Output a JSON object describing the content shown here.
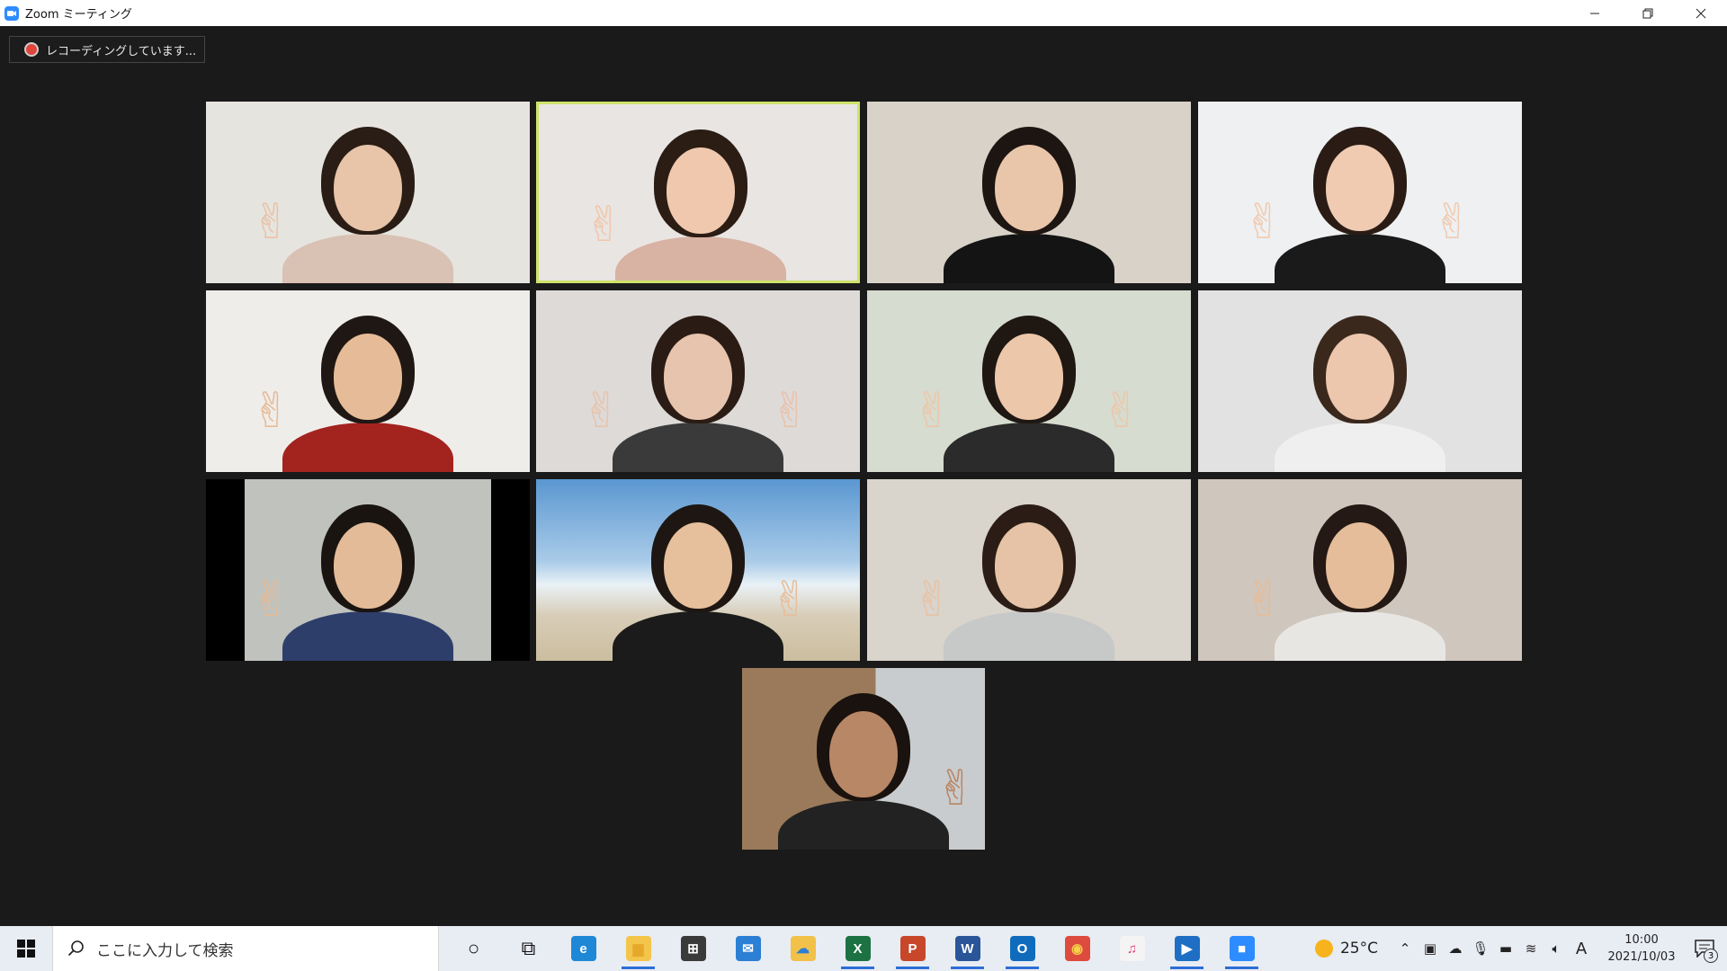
{
  "window": {
    "title": "Zoom ミーティング",
    "controls": [
      "minimize-button",
      "restore-button",
      "close-button"
    ]
  },
  "recording": {
    "label": "レコーディングしています..."
  },
  "participants": [
    {
      "id": "p1",
      "active": false,
      "bg": "#e6e4df",
      "skin": "#e8c4a8",
      "hair": "#2a1d16",
      "top": "#d9c1b4",
      "peace": "left"
    },
    {
      "id": "p2",
      "active": true,
      "bg": "#e9e5e2",
      "skin": "#efc8ad",
      "hair": "#2b1c14",
      "top": "#d8b2a3",
      "peace": "left"
    },
    {
      "id": "p3",
      "active": false,
      "bg": "#d8d2c8",
      "skin": "#e9c6aa",
      "hair": "#1d1512",
      "top": "#141414",
      "peace": "none"
    },
    {
      "id": "p4",
      "active": false,
      "bg": "#eef0f2",
      "skin": "#f0cbb1",
      "hair": "#2a1c15",
      "top": "#1a1a1a",
      "peace": "both"
    },
    {
      "id": "p5",
      "active": false,
      "bg": "#efedea",
      "skin": "#e6bc98",
      "hair": "#1f1713",
      "top": "#a3231f",
      "peace": "left"
    },
    {
      "id": "p6",
      "active": false,
      "bg": "#dedad8",
      "skin": "#e7c4ad",
      "hair": "#2a1c15",
      "top": "#3a3a3a",
      "peace": "both"
    },
    {
      "id": "p7",
      "active": false,
      "bg": "#d6dccf",
      "skin": "#ecc7aa",
      "hair": "#1f1712",
      "top": "#2b2b2b",
      "peace": "both"
    },
    {
      "id": "p8",
      "active": false,
      "bg": "#e2e2e2",
      "skin": "#ecc6ad",
      "hair": "#3a281d",
      "top": "#efefef",
      "peace": "none"
    },
    {
      "id": "p9",
      "active": false,
      "bg": "#cfd0cb",
      "skin": "#e3bb98",
      "hair": "#1a1411",
      "top": "#2e3e6b",
      "peace": "left"
    },
    {
      "id": "p10",
      "active": false,
      "bg": "#6ba4d8",
      "skin": "#e6bf9c",
      "hair": "#1e1612",
      "top": "#1b1b1b",
      "peace": "right"
    },
    {
      "id": "p11",
      "active": false,
      "bg": "#d9d4cc",
      "skin": "#e6c3a6",
      "hair": "#2b1d15",
      "top": "#c7c8c8",
      "peace": "left"
    },
    {
      "id": "p12",
      "active": false,
      "bg": "#cfc6bd",
      "skin": "#e5bd9a",
      "hair": "#241914",
      "top": "#e8e6e3",
      "peace": "left"
    },
    {
      "id": "p13",
      "active": false,
      "bg": "#9a7a5a",
      "skin": "#b88766",
      "hair": "#1a120e",
      "top": "#222222",
      "peace": "right"
    }
  ],
  "taskbar": {
    "search_placeholder": "ここに入力して検索",
    "apps": [
      {
        "name": "cortana-icon",
        "glyph": "○",
        "color": "transparent",
        "fg": "#111",
        "running": false
      },
      {
        "name": "task-view-icon",
        "glyph": "⧉",
        "color": "transparent",
        "fg": "#111",
        "running": false
      },
      {
        "name": "edge-icon",
        "glyph": "e",
        "color": "#1f88d6",
        "fg": "#fff",
        "running": false
      },
      {
        "name": "file-explorer-icon",
        "glyph": "▆",
        "color": "#f3c54b",
        "fg": "#e6a82a",
        "running": true
      },
      {
        "name": "store-icon",
        "glyph": "⊞",
        "color": "#3a3a3a",
        "fg": "#fff",
        "running": false
      },
      {
        "name": "mail-icon",
        "glyph": "✉",
        "color": "#2b7fd4",
        "fg": "#fff",
        "running": false
      },
      {
        "name": "onedrive-folder-icon",
        "glyph": "☁",
        "color": "#f2c14a",
        "fg": "#2b7fd4",
        "running": false
      },
      {
        "name": "excel-icon",
        "glyph": "X",
        "color": "#1d7244",
        "fg": "#fff",
        "running": true
      },
      {
        "name": "powerpoint-icon",
        "glyph": "P",
        "color": "#c8472a",
        "fg": "#fff",
        "running": true
      },
      {
        "name": "word-icon",
        "glyph": "W",
        "color": "#2a5699",
        "fg": "#fff",
        "running": true
      },
      {
        "name": "outlook-icon",
        "glyph": "O",
        "color": "#0f6cbd",
        "fg": "#fff",
        "running": true
      },
      {
        "name": "chrome-icon",
        "glyph": "◉",
        "color": "#dd4b3e",
        "fg": "#f7d04a",
        "running": false
      },
      {
        "name": "itunes-icon",
        "glyph": "♫",
        "color": "#f4f4f4",
        "fg": "#e0407a",
        "running": false
      },
      {
        "name": "video-player-icon",
        "glyph": "▶",
        "color": "#1e6fc4",
        "fg": "#fff",
        "running": true
      },
      {
        "name": "zoom-icon",
        "glyph": "■",
        "color": "#2d8cff",
        "fg": "#fff",
        "running": true
      }
    ]
  },
  "tray": {
    "temperature": "25°C",
    "time": "10:00",
    "date": "2021/10/03",
    "ime": "A",
    "notification_count": "3"
  }
}
